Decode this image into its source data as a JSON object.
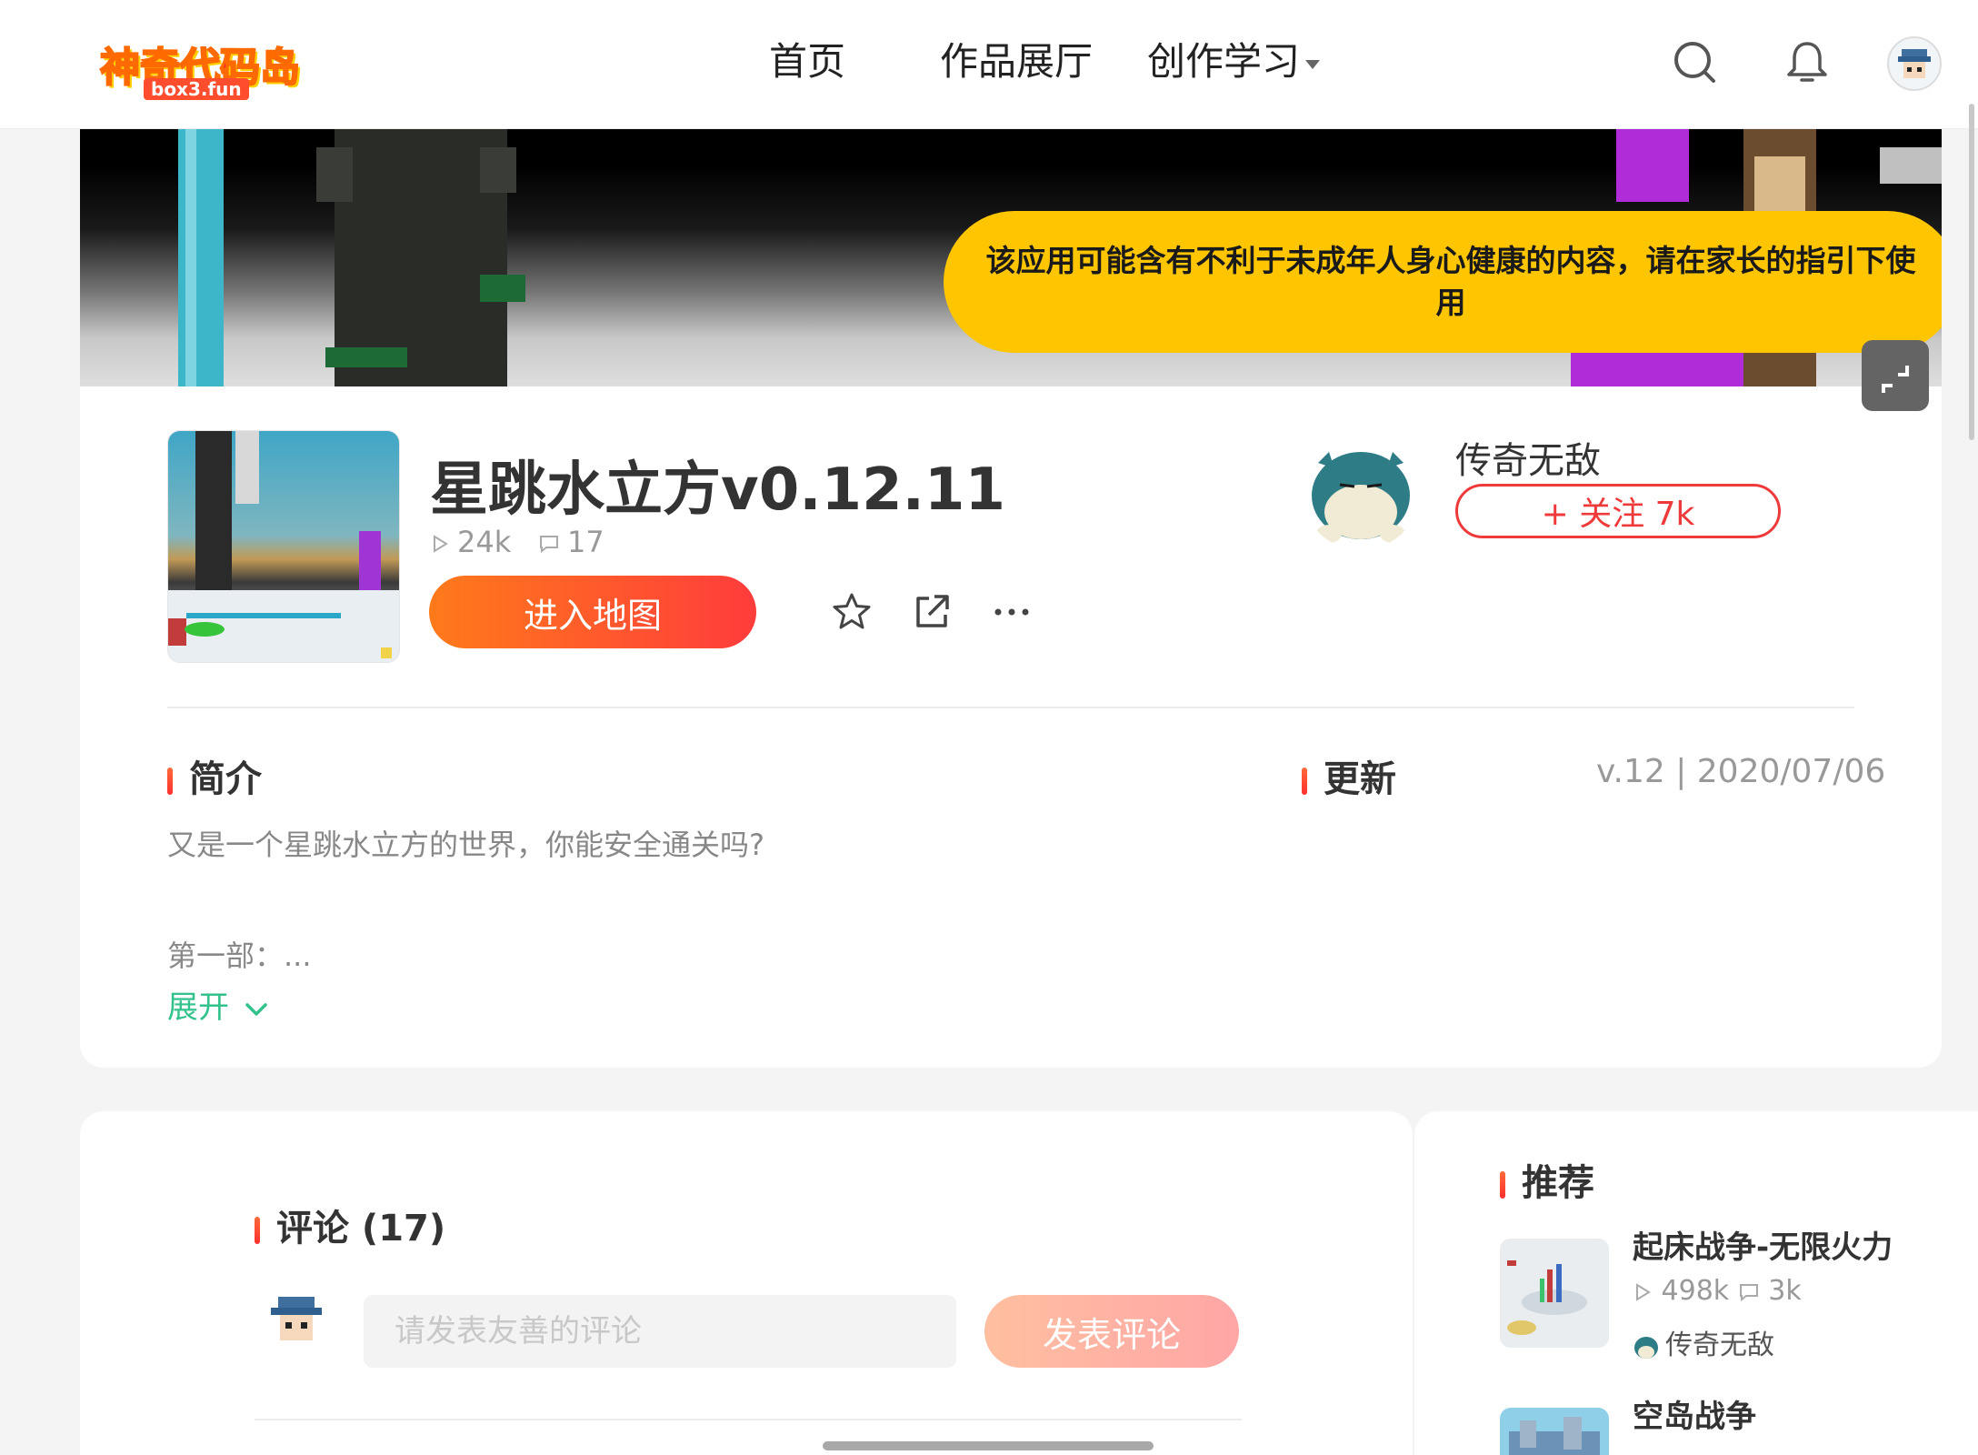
{
  "header": {
    "logo_text": "神奇代码岛",
    "logo_sub": "box3.fun",
    "nav": [
      "首页",
      "作品展厅",
      "创作学习"
    ]
  },
  "banner": {
    "warning": "该应用可能含有不利于未成年人身心健康的内容，请在家长的指引下使用"
  },
  "game": {
    "title": "星跳水立方v0.12.11",
    "plays": "24k",
    "comments": "17",
    "enter_label": "进入地图"
  },
  "author": {
    "name": "传奇无敌",
    "follow_label": "+ 关注 7k"
  },
  "intro": {
    "heading": "简介",
    "line1": "又是一个星跳水立方的世界，你能安全通关吗?",
    "line2": "第一部：...",
    "expand_label": "展开"
  },
  "update": {
    "heading": "更新",
    "version": "v.12 | 2020/07/06"
  },
  "comments": {
    "heading": "评论 (17)",
    "placeholder": "请发表友善的评论",
    "post_label": "发表评论"
  },
  "recommend": {
    "heading": "推荐",
    "items": [
      {
        "title": "起床战争-无限火力",
        "plays": "498k",
        "comments": "3k",
        "author": "传奇无敌"
      },
      {
        "title": "空岛战争"
      }
    ]
  },
  "colors": {
    "accent": "#ff3c3c",
    "enter_gradient_start": "#ff7a1a",
    "warning": "#ffc600",
    "expand": "#34c28c"
  }
}
